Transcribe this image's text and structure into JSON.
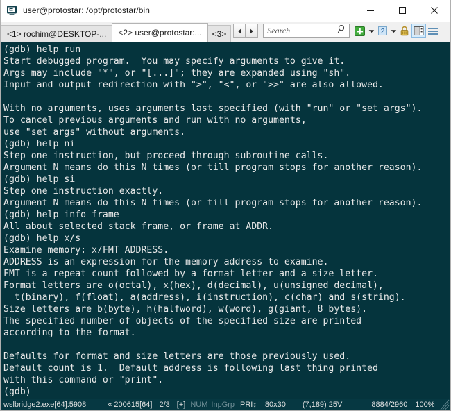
{
  "window": {
    "title": "user@protostar: /opt/protostar/bin",
    "icon": "conemu-icon",
    "minimize_label": "—",
    "maximize_label": "□",
    "close_label": "✕"
  },
  "tabs": [
    {
      "label": "<1> rochim@DESKTOP-...",
      "active": false
    },
    {
      "label": "<2> user@protostar:...",
      "active": true
    },
    {
      "label": "<3>",
      "active": false
    }
  ],
  "tab_nav": {
    "prev_label": "◄",
    "next_label": "►"
  },
  "search": {
    "value": "",
    "placeholder": "Search",
    "icon": "search-icon"
  },
  "toolbar": {
    "new_console_icon": "plus-icon",
    "new_console_caret": "▾",
    "active_console_label": "2",
    "console_caret": "▾",
    "lock_icon": "padlock-icon",
    "split_pane_icon": "split-pane-icon",
    "menu_icon": "hamburger-menu-icon"
  },
  "terminal": {
    "background": "#05343d",
    "foreground": "#e8e8e8",
    "lines": [
      "(gdb) help run",
      "Start debugged program.  You may specify arguments to give it.",
      "Args may include \"*\", or \"[...]\"; they are expanded using \"sh\".",
      "Input and output redirection with \">\", \"<\", or \">>\" are also allowed.",
      "",
      "With no arguments, uses arguments last specified (with \"run\" or \"set args\").",
      "To cancel previous arguments and run with no arguments,",
      "use \"set args\" without arguments.",
      "(gdb) help ni",
      "Step one instruction, but proceed through subroutine calls.",
      "Argument N means do this N times (or till program stops for another reason).",
      "(gdb) help si",
      "Step one instruction exactly.",
      "Argument N means do this N times (or till program stops for another reason).",
      "(gdb) help info frame",
      "All about selected stack frame, or frame at ADDR.",
      "(gdb) help x/s",
      "Examine memory: x/FMT ADDRESS.",
      "ADDRESS is an expression for the memory address to examine.",
      "FMT is a repeat count followed by a format letter and a size letter.",
      "Format letters are o(octal), x(hex), d(decimal), u(unsigned decimal),",
      "  t(binary), f(float), a(address), i(instruction), c(char) and s(string).",
      "Size letters are b(byte), h(halfword), w(word), g(giant, 8 bytes).",
      "The specified number of objects of the specified size are printed",
      "according to the format.",
      "",
      "Defaults for format and size letters are those previously used.",
      "Default count is 1.  Default address is following last thing printed",
      "with this command or \"print\".",
      "(gdb)"
    ]
  },
  "statusbar": {
    "process": "wslbridge2.exe[64]:5908",
    "console_marker": "« 200615[64]",
    "tab_position": "2/3",
    "scroll_flag": "[+]",
    "num_lock": "NUM",
    "input_group": "InpGrp",
    "priority": "PRI↕",
    "size": "80x30",
    "cursor_position": "(7,189) 25V",
    "buffer": "8884/2960",
    "zoom": "100%"
  }
}
